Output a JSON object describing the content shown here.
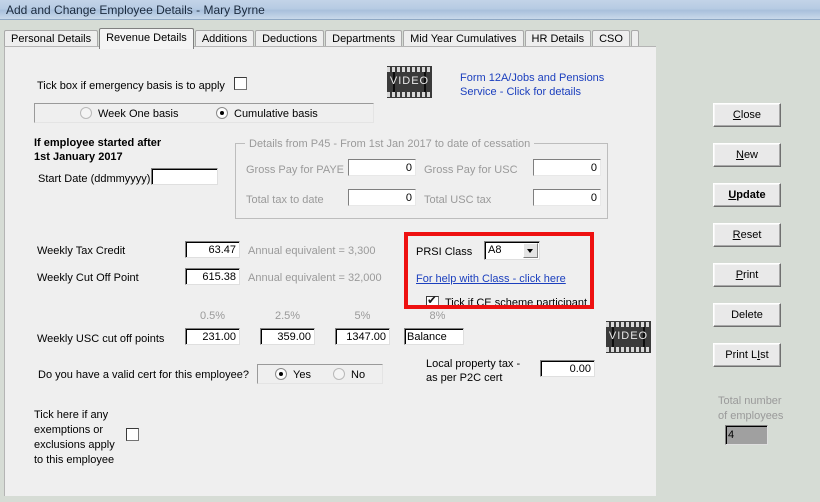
{
  "window": {
    "title": "Add and Change Employee Details - Mary Byrne"
  },
  "tabs": [
    {
      "label": "Personal Details",
      "selected": false
    },
    {
      "label": "Revenue Details",
      "selected": true
    },
    {
      "label": "Additions",
      "selected": false
    },
    {
      "label": "Deductions",
      "selected": false
    },
    {
      "label": "Departments",
      "selected": false
    },
    {
      "label": "Mid Year Cumulatives",
      "selected": false
    },
    {
      "label": "HR Details",
      "selected": false
    },
    {
      "label": "CSO",
      "selected": false
    }
  ],
  "form": {
    "emergency_label": "Tick box if emergency basis is to apply",
    "emergency_checked": false,
    "basis_options": [
      {
        "label": "Week One basis",
        "selected": false
      },
      {
        "label": "Cumulative basis",
        "selected": true
      }
    ],
    "video_label": "VIDEO",
    "form12a_link_line1": "Form 12A/Jobs and Pensions",
    "form12a_link_line2": "Service - Click for details",
    "started_after_line1": "If employee started after",
    "started_after_line2": "1st January 2017",
    "start_date_label": "Start Date (ddmmyyyy)",
    "start_date_value": "",
    "p45": {
      "group_title": "Details from P45 - From 1st Jan 2017 to date of cessation",
      "fields": [
        {
          "label": "Gross Pay for PAYE",
          "value": "0"
        },
        {
          "label": "Gross Pay for USC",
          "value": "0"
        },
        {
          "label": "Total tax to date",
          "value": "0"
        },
        {
          "label": "Total USC tax",
          "value": "0"
        }
      ]
    },
    "weekly_tax_credit_label": "Weekly Tax Credit",
    "weekly_tax_credit_value": "63.47",
    "weekly_tax_credit_annual": "Annual equivalent = 3,300",
    "weekly_cut_off_label": "Weekly Cut Off Point",
    "weekly_cut_off_value": "615.38",
    "weekly_cut_off_annual": "Annual equivalent = 32,000",
    "prsi_class_label": "PRSI Class",
    "prsi_class_value": "A8",
    "prsi_help_link": "For help with Class - click here",
    "ce_scheme_label": "Tick if CE scheme participant",
    "ce_scheme_checked": true,
    "usc_label": "Weekly USC cut off points",
    "usc_bands": [
      {
        "rate": "0.5%",
        "value": "231.00"
      },
      {
        "rate": "2.5%",
        "value": "359.00"
      },
      {
        "rate": "5%",
        "value": "1347.00"
      },
      {
        "rate": "8%",
        "value": "Balance"
      }
    ],
    "valid_cert_label": "Do you have a valid cert for this employee?",
    "valid_cert_options": [
      {
        "label": "Yes",
        "selected": true
      },
      {
        "label": "No",
        "selected": false
      }
    ],
    "local_property_tax_line1": "Local property tax -",
    "local_property_tax_line2": "as per P2C cert",
    "local_property_tax_value": "0.00",
    "exemptions_line1": "Tick here if any",
    "exemptions_line2": "exemptions or",
    "exemptions_line3": "exclusions apply",
    "exemptions_line4": "to this employee",
    "exemptions_checked": false
  },
  "buttons": [
    {
      "label": "Close",
      "acc": "C",
      "default": false
    },
    {
      "label": "New",
      "acc": "N",
      "default": false
    },
    {
      "label": "Update",
      "acc": "U",
      "default": true
    },
    {
      "label": "Reset",
      "acc": "R",
      "default": false
    },
    {
      "label": "Print",
      "acc": "P",
      "default": false
    },
    {
      "label": "Delete",
      "acc": "",
      "default": false
    },
    {
      "label": "Print List",
      "acc": "I",
      "default": false
    }
  ],
  "totals": {
    "label_line1": "Total number",
    "label_line2": "of employees",
    "value": "4"
  },
  "colors": {
    "dialog_bg": "#d6dcd5",
    "panel_bg": "#efefef",
    "titlebar": "#b7cbe3",
    "link": "#1b3fbe",
    "highlight": "#ee1111",
    "disabled_text": "#9a9a9a"
  }
}
